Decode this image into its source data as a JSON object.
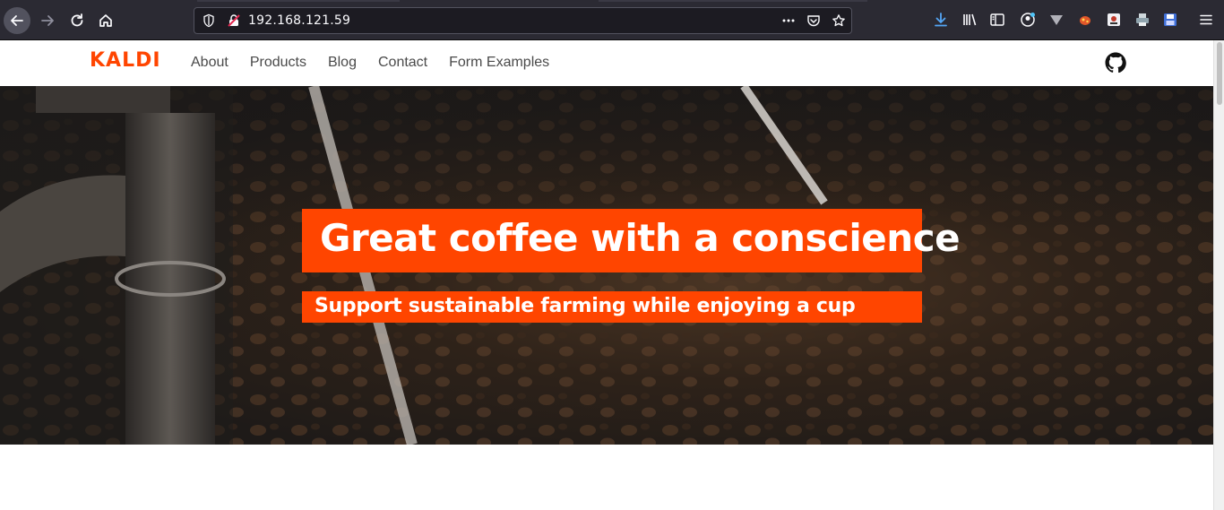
{
  "browser": {
    "url": "192.168.121.59",
    "icons": [
      "back-icon",
      "forward-icon",
      "reload-icon",
      "home-icon",
      "shield-icon",
      "insecure-lock-icon",
      "more-dots-icon",
      "pocket-icon",
      "bookmark-star-icon",
      "download-icon",
      "library-icon",
      "sidebar-icon",
      "account-icon",
      "extension-icon",
      "menu-icon"
    ]
  },
  "site": {
    "logo": "KALDI",
    "nav": {
      "about": "About",
      "products": "Products",
      "blog": "Blog",
      "contact": "Contact",
      "form_examples": "Form Examples"
    },
    "accent_color": "#ff4500"
  },
  "hero": {
    "title": "Great coffee with a conscience",
    "subtitle": "Support sustainable farming while enjoying a cup"
  }
}
